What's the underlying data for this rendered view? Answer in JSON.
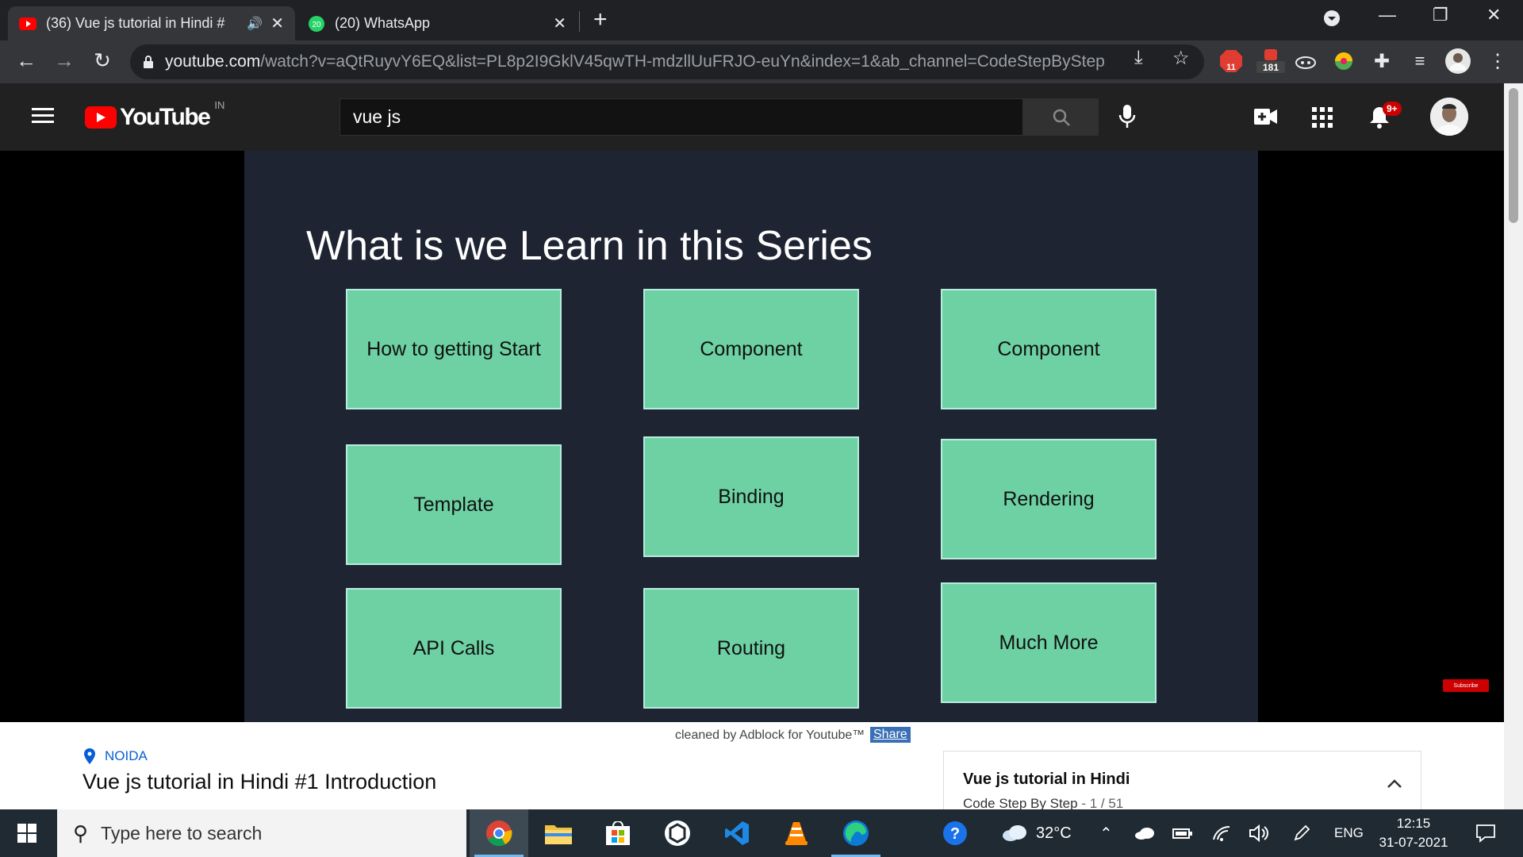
{
  "browser": {
    "tabs": [
      {
        "title": "(36) Vue js tutorial in Hindi #",
        "close": "✕"
      },
      {
        "title": "(20) WhatsApp",
        "close": "✕",
        "badge": "20"
      }
    ],
    "new_tab": "+",
    "url_host": "youtube.com",
    "url_rest": "/watch?v=aQtRuyvY6EQ&list=PL8p2I9GklV45qwTH-mdzllUuFRJO-euYn&index=1&ab_channel=CodeStepByStep",
    "extensions": [
      {
        "name": "abp",
        "count": "11"
      },
      {
        "name": "ext2",
        "count": "181"
      }
    ]
  },
  "youtube": {
    "logo_text": "YouTube",
    "country_code": "IN",
    "search_value": "vue js",
    "notifications_badge": "9+"
  },
  "video": {
    "slide_title": "What is we Learn in this Series",
    "boxes": [
      "How to getting Start",
      "Component",
      "Component",
      "Template",
      "Binding",
      "Rendering",
      "API Calls",
      "Routing",
      "Much More"
    ],
    "subscribe_watermark": "Subscribe"
  },
  "below_video": {
    "adblock_text": "cleaned by Adblock for Youtube™",
    "share_label": "Share",
    "location": "NOIDA",
    "video_title": "Vue js tutorial in Hindi #1 Introduction"
  },
  "playlist": {
    "title": "Vue js tutorial in Hindi",
    "channel": "Code Step By Step",
    "position": " - 1 / 51"
  },
  "taskbar": {
    "search_placeholder": "Type here to search",
    "temperature": "32°C",
    "language": "ENG",
    "time": "12:15",
    "date": "31-07-2021"
  },
  "colors": {
    "slide_bg": "#1f2433",
    "box_fill": "#6dd1a3",
    "youtube_red": "#ff0000"
  }
}
